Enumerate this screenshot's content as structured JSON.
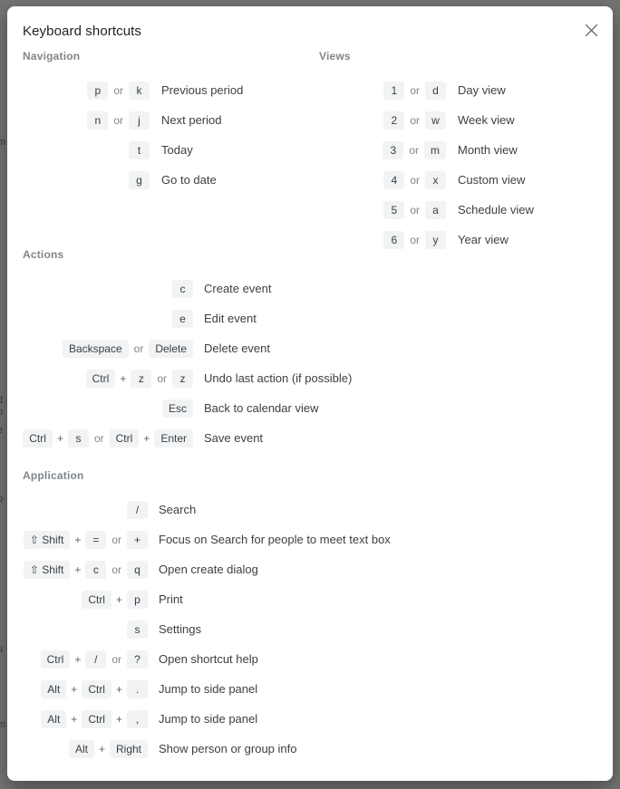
{
  "backdrop": {
    "clipped_fragments": [
      "m",
      "d",
      "o",
      "e",
      "p",
      "u",
      "m"
    ]
  },
  "dialog": {
    "title": "Keyboard shortcuts",
    "close_icon": "close-icon",
    "close_label": "Close"
  },
  "separators": {
    "or": "or",
    "plus": "+"
  },
  "sections": [
    {
      "id": "navigation",
      "title": "Navigation",
      "rows": [
        {
          "keys": [
            "p"
          ],
          "alt_keys": [
            "k"
          ],
          "desc": "Previous period"
        },
        {
          "keys": [
            "n"
          ],
          "alt_keys": [
            "j"
          ],
          "desc": "Next period"
        },
        {
          "keys": [
            "t"
          ],
          "alt_keys": [],
          "desc": "Today"
        },
        {
          "keys": [
            "g"
          ],
          "alt_keys": [],
          "desc": "Go to date"
        }
      ]
    },
    {
      "id": "views",
      "title": "Views",
      "rows": [
        {
          "keys": [
            "1"
          ],
          "alt_keys": [
            "d"
          ],
          "desc": "Day view"
        },
        {
          "keys": [
            "2"
          ],
          "alt_keys": [
            "w"
          ],
          "desc": "Week view"
        },
        {
          "keys": [
            "3"
          ],
          "alt_keys": [
            "m"
          ],
          "desc": "Month view"
        },
        {
          "keys": [
            "4"
          ],
          "alt_keys": [
            "x"
          ],
          "desc": "Custom view"
        },
        {
          "keys": [
            "5"
          ],
          "alt_keys": [
            "a"
          ],
          "desc": "Schedule view"
        },
        {
          "keys": [
            "6"
          ],
          "alt_keys": [
            "y"
          ],
          "desc": "Year view"
        }
      ]
    },
    {
      "id": "actions",
      "title": "Actions",
      "rows": [
        {
          "keys": [
            "c"
          ],
          "alt_keys": [],
          "desc": "Create event"
        },
        {
          "keys": [
            "e"
          ],
          "alt_keys": [],
          "desc": "Edit event"
        },
        {
          "keys": [
            "Backspace"
          ],
          "alt_keys": [
            "Delete"
          ],
          "desc": "Delete event"
        },
        {
          "keys": [
            "Ctrl",
            "z"
          ],
          "alt_keys": [
            "z"
          ],
          "desc": "Undo last action (if possible)"
        },
        {
          "keys": [
            "Esc"
          ],
          "alt_keys": [],
          "desc": "Back to calendar view"
        },
        {
          "keys": [
            "Ctrl",
            "s"
          ],
          "alt_keys": [
            "Ctrl",
            "Enter"
          ],
          "desc": "Save event"
        }
      ]
    },
    {
      "id": "application",
      "title": "Application",
      "rows": [
        {
          "keys": [
            "/"
          ],
          "alt_keys": [],
          "desc": "Search"
        },
        {
          "keys": [
            "⇧ Shift",
            "="
          ],
          "alt_keys": [
            "+"
          ],
          "desc": "Focus on Search for people to meet text box"
        },
        {
          "keys": [
            "⇧ Shift",
            "c"
          ],
          "alt_keys": [
            "q"
          ],
          "desc": "Open create dialog"
        },
        {
          "keys": [
            "Ctrl",
            "p"
          ],
          "alt_keys": [],
          "desc": "Print"
        },
        {
          "keys": [
            "s"
          ],
          "alt_keys": [],
          "desc": "Settings"
        },
        {
          "keys": [
            "Ctrl",
            "/"
          ],
          "alt_keys": [
            "?"
          ],
          "desc": "Open shortcut help"
        },
        {
          "keys": [
            "Alt",
            "Ctrl",
            "."
          ],
          "alt_keys": [],
          "desc": "Jump to side panel"
        },
        {
          "keys": [
            "Alt",
            "Ctrl",
            ","
          ],
          "alt_keys": [],
          "desc": "Jump to side panel"
        },
        {
          "keys": [
            "Alt",
            "Right"
          ],
          "alt_keys": [],
          "desc": "Show person or group info"
        }
      ]
    }
  ],
  "colors": {
    "backdrop": "#737373",
    "dialog_bg": "#ffffff",
    "key_bg": "#f1f3f4",
    "text": "#3c4043",
    "muted": "#80868b"
  }
}
